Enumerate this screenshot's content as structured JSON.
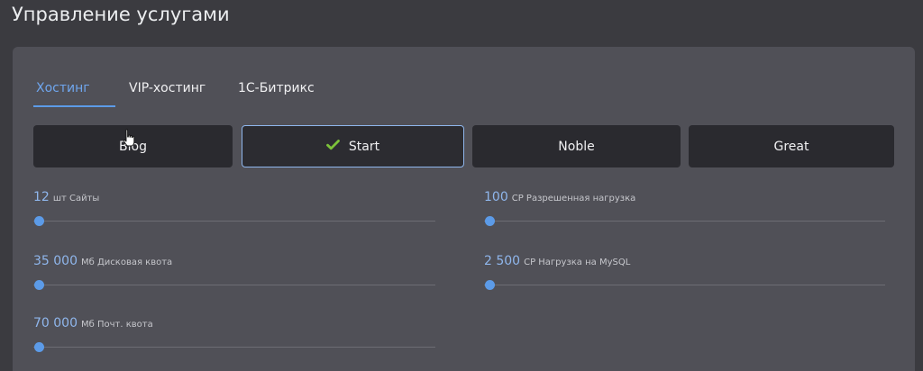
{
  "page": {
    "title": "Управление услугами"
  },
  "tabs": [
    {
      "label": "Хостинг",
      "active": true
    },
    {
      "label": "VIP-хостинг",
      "active": false
    },
    {
      "label": "1С-Битрикс",
      "active": false
    }
  ],
  "plans": [
    {
      "label": "Blog",
      "selected": false
    },
    {
      "label": "Start",
      "selected": true
    },
    {
      "label": "Noble",
      "selected": false
    },
    {
      "label": "Great",
      "selected": false
    }
  ],
  "params": {
    "sites": {
      "value": "12",
      "label": "шт Сайты"
    },
    "cp_load": {
      "value": "100",
      "label": "CP Разрешенная нагрузка"
    },
    "disk": {
      "value": "35 000",
      "label": "Мб Дисковая квота"
    },
    "mysql": {
      "value": "2 500",
      "label": "CP Нагрузка на MySQL"
    },
    "mail": {
      "value": "70 000",
      "label": "Мб Почт. квота"
    }
  },
  "colors": {
    "accent": "#5c9be8",
    "background": "#3b3b40",
    "panel": "#505057",
    "button": "#2a2a2f",
    "check": "#7cc23a"
  },
  "icons": {
    "selected_plan": "check-icon",
    "pointer": "hand-pointer-icon"
  }
}
